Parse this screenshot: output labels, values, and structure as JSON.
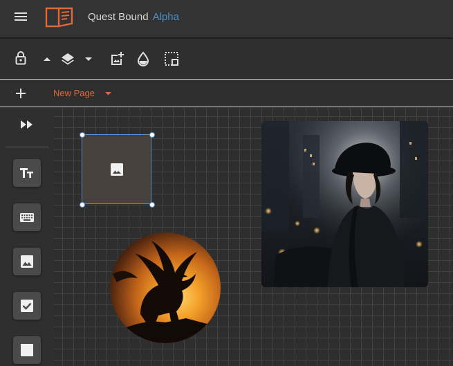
{
  "appbar": {
    "app_name": "Quest Bound",
    "tag": "Alpha",
    "icons": [
      "menu-icon",
      "book-logo-icon"
    ]
  },
  "toolbar": {
    "icons": [
      "lock-icon",
      "arrow-up-icon",
      "layers-icon",
      "dropdown-icon",
      "add-image-icon",
      "opacity-icon",
      "selection-box-icon"
    ]
  },
  "pagebar": {
    "add_icon": "add-icon",
    "page_label": "New Page",
    "dropdown_icon": "dropdown-icon"
  },
  "sidebar": {
    "collapse_icon": "fast-forward-icon",
    "tools": [
      "text-tool-icon",
      "keyboard-tool-icon",
      "image-tool-icon",
      "checkbox-tool-icon",
      "square-tool-icon"
    ]
  },
  "canvas": {
    "components": [
      "image-placeholder",
      "dragon-image",
      "woman-photo"
    ]
  },
  "colors": {
    "accent": "#e0683a",
    "alpha_tag": "#4a8fc9",
    "selection": "#5a90c8",
    "appbar_bg": "#333333"
  }
}
